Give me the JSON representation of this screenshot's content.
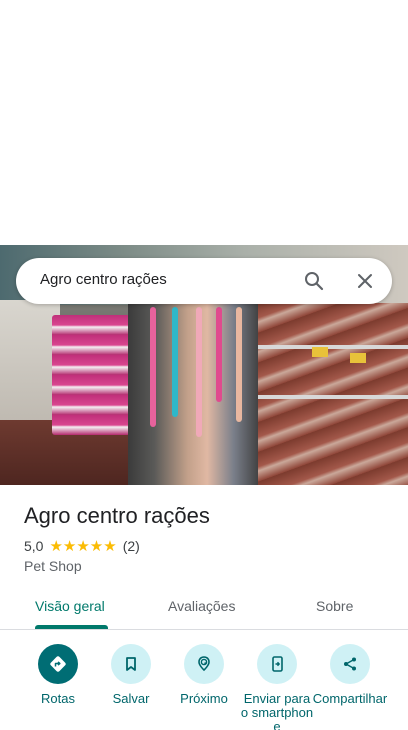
{
  "search": {
    "query": "Agro centro rações"
  },
  "place": {
    "name": "Agro centro rações",
    "rating": "5,0",
    "stars": "★★★★★",
    "review_count": "(2)",
    "category": "Pet Shop"
  },
  "tabs": [
    {
      "label": "Visão geral",
      "active": true
    },
    {
      "label": "Avaliações",
      "active": false
    },
    {
      "label": "Sobre",
      "active": false
    }
  ],
  "actions": [
    {
      "label": "Rotas",
      "icon": "directions-icon"
    },
    {
      "label": "Salvar",
      "icon": "bookmark-icon"
    },
    {
      "label": "Próximo",
      "icon": "nearby-icon"
    },
    {
      "label": "Enviar para o smartphone",
      "icon": "send-to-phone-icon"
    },
    {
      "label": "Compartilhar",
      "icon": "share-icon"
    }
  ],
  "colors": {
    "accent": "#00796b",
    "primary_button": "#006d74",
    "action_bg": "#cff1f5",
    "star": "#fbbc04"
  }
}
